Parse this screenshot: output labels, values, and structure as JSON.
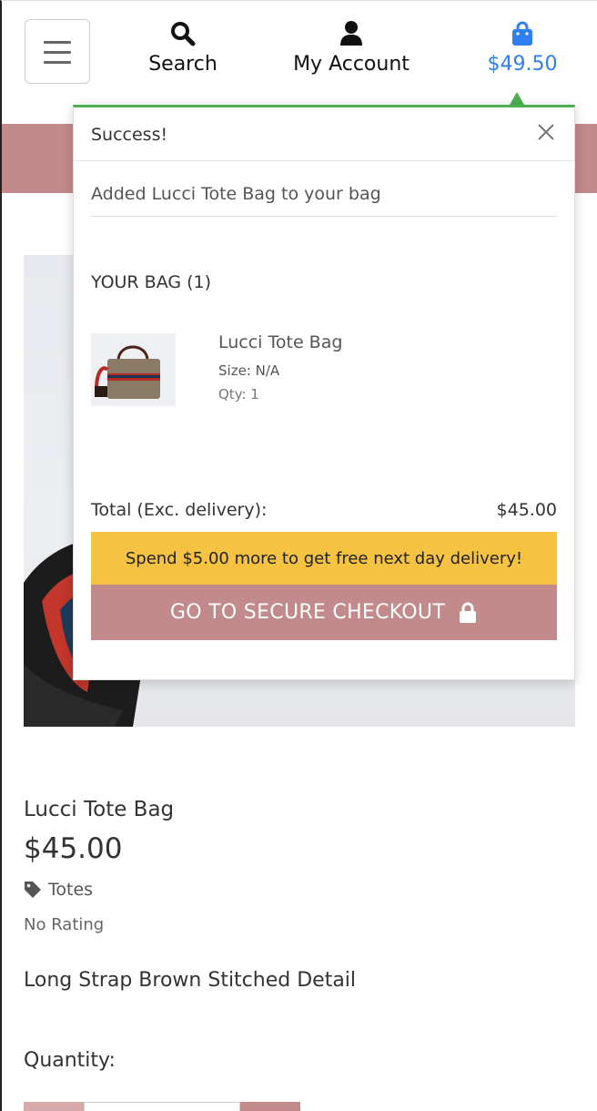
{
  "header": {
    "menu_label": "",
    "search_label": "Search",
    "account_label": "My Account",
    "bag_total": "$49.50",
    "bag_color": "#2f7ff0"
  },
  "toast": {
    "title": "Success!",
    "message": "Added Lucci Tote Bag to your bag",
    "bag_heading": "YOUR BAG (1)",
    "item": {
      "name": "Lucci Tote Bag",
      "size": "Size: N/A",
      "qty": "Qty: 1"
    },
    "total_label": "Total (Exc. delivery):",
    "total_value": "$45.00",
    "delivery_note": "Spend $5.00 more to get free next day delivery!",
    "checkout_label": "GO TO SECURE CHECKOUT",
    "accent_color": "#4caf50"
  },
  "product": {
    "name": "Lucci Tote Bag",
    "price": "$45.00",
    "category": "Totes",
    "rating": "No Rating",
    "description": "Long Strap Brown Stitched Detail",
    "quantity_label": "Quantity:"
  },
  "colors": {
    "brand_pink": "#c28a8a",
    "notice_yellow": "#f5c242",
    "link_blue": "#2f7ff0"
  },
  "icons": {
    "menu": "hamburger-icon",
    "search": "search-icon",
    "account": "user-icon",
    "bag": "shopping-bag-icon",
    "close": "close-icon",
    "category": "tag-icon",
    "checkout": "lock-icon"
  }
}
